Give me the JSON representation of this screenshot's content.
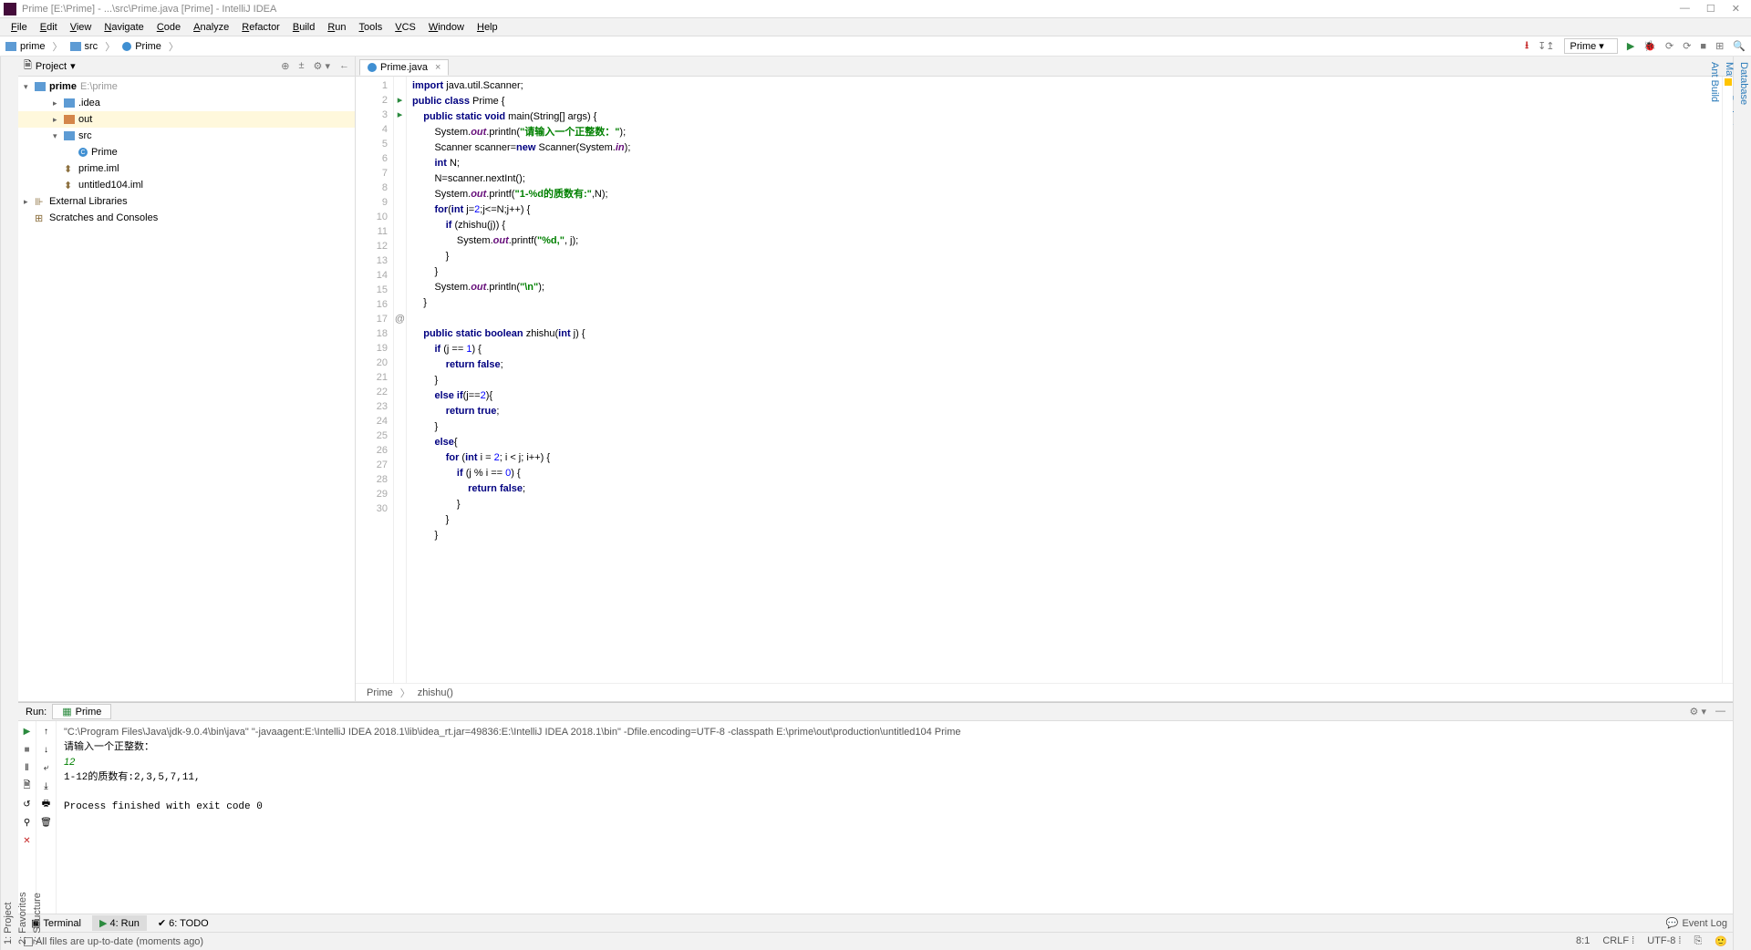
{
  "window": {
    "title": "Prime [E:\\Prime] - ...\\src\\Prime.java [Prime] - IntelliJ IDEA"
  },
  "menu": [
    "File",
    "Edit",
    "View",
    "Navigate",
    "Code",
    "Analyze",
    "Refactor",
    "Build",
    "Run",
    "Tools",
    "VCS",
    "Window",
    "Help"
  ],
  "breadcrumb": {
    "root": "prime",
    "mid": "src",
    "leaf": "Prime"
  },
  "toolbar": {
    "run_config": "Prime"
  },
  "project_panel": {
    "title": "Project",
    "root_name": "prime",
    "root_path": "E:\\prime",
    "children": [
      {
        "name": ".idea",
        "kind": "folder",
        "indent": 1,
        "exp": "▸"
      },
      {
        "name": "out",
        "kind": "folder-orange",
        "indent": 1,
        "exp": "▸",
        "selected": true
      },
      {
        "name": "src",
        "kind": "folder",
        "indent": 1,
        "exp": "▾"
      },
      {
        "name": "Prime",
        "kind": "class",
        "indent": 2,
        "exp": ""
      },
      {
        "name": "prime.iml",
        "kind": "iml",
        "indent": 1,
        "exp": ""
      },
      {
        "name": "untitled104.iml",
        "kind": "iml",
        "indent": 1,
        "exp": ""
      }
    ],
    "external_libs": "External Libraries",
    "scratches": "Scratches and Consoles"
  },
  "editor": {
    "tab_name": "Prime.java",
    "breadcrumb": {
      "cls": "Prime",
      "method": "zhishu()"
    },
    "lines": [
      {
        "n": 1,
        "tokens": [
          [
            "kw",
            "import "
          ],
          [
            "",
            "java.util.Scanner;"
          ]
        ]
      },
      {
        "n": 2,
        "mark": "▸",
        "tokens": [
          [
            "kw",
            "public class "
          ],
          [
            "",
            "Prime {"
          ]
        ]
      },
      {
        "n": 3,
        "mark": "▸",
        "tokens": [
          [
            "",
            "    "
          ],
          [
            "kw",
            "public static void "
          ],
          [
            "",
            "main(String[] args) {"
          ]
        ]
      },
      {
        "n": 4,
        "tokens": [
          [
            "",
            "        System."
          ],
          [
            "fld",
            "out"
          ],
          [
            "",
            ".println("
          ],
          [
            "str",
            "\"请输入一个正整数：\""
          ],
          [
            "",
            ");"
          ]
        ]
      },
      {
        "n": 5,
        "tokens": [
          [
            "",
            "        Scanner scanner="
          ],
          [
            "kw",
            "new "
          ],
          [
            "",
            "Scanner(System."
          ],
          [
            "fld",
            "in"
          ],
          [
            "",
            ");"
          ]
        ]
      },
      {
        "n": 6,
        "tokens": [
          [
            "",
            "        "
          ],
          [
            "kw",
            "int "
          ],
          [
            "",
            "N;"
          ]
        ]
      },
      {
        "n": 7,
        "tokens": [
          [
            "",
            "        N=scanner.nextInt();"
          ]
        ]
      },
      {
        "n": 8,
        "tokens": [
          [
            "",
            "        System."
          ],
          [
            "fld",
            "out"
          ],
          [
            "",
            ".printf("
          ],
          [
            "str",
            "\"1-%d的质数有:\""
          ],
          [
            "",
            ",N);"
          ]
        ]
      },
      {
        "n": 9,
        "tokens": [
          [
            "",
            "        "
          ],
          [
            "kw",
            "for"
          ],
          [
            "",
            "("
          ],
          [
            "kw",
            "int "
          ],
          [
            "",
            "j="
          ],
          [
            "num",
            "2"
          ],
          [
            "",
            ";j<=N;j++) {"
          ]
        ]
      },
      {
        "n": 10,
        "tokens": [
          [
            "",
            "            "
          ],
          [
            "kw",
            "if "
          ],
          [
            "",
            "("
          ],
          [
            "",
            "zhishu"
          ],
          [
            "",
            "(j)) {"
          ]
        ]
      },
      {
        "n": 11,
        "tokens": [
          [
            "",
            "                System."
          ],
          [
            "fld",
            "out"
          ],
          [
            "",
            ".printf("
          ],
          [
            "str",
            "\"%d,\""
          ],
          [
            "",
            ", j);"
          ]
        ]
      },
      {
        "n": 12,
        "tokens": [
          [
            "",
            "            }"
          ]
        ]
      },
      {
        "n": 13,
        "tokens": [
          [
            "",
            "        }"
          ]
        ]
      },
      {
        "n": 14,
        "tokens": [
          [
            "",
            "        System."
          ],
          [
            "fld",
            "out"
          ],
          [
            "",
            ".println("
          ],
          [
            "str",
            "\"\\n\""
          ],
          [
            "",
            ");"
          ]
        ]
      },
      {
        "n": 15,
        "tokens": [
          [
            "",
            "    }"
          ]
        ]
      },
      {
        "n": 16,
        "tokens": [
          [
            "",
            ""
          ]
        ]
      },
      {
        "n": 17,
        "mark": "@",
        "tokens": [
          [
            "",
            "    "
          ],
          [
            "kw",
            "public static boolean "
          ],
          [
            "",
            "zhishu("
          ],
          [
            "kw",
            "int "
          ],
          [
            "",
            "j) {"
          ]
        ]
      },
      {
        "n": 18,
        "tokens": [
          [
            "",
            "        "
          ],
          [
            "kw",
            "if "
          ],
          [
            "",
            "(j == "
          ],
          [
            "num",
            "1"
          ],
          [
            "",
            ") {"
          ]
        ]
      },
      {
        "n": 19,
        "tokens": [
          [
            "",
            "            "
          ],
          [
            "kw",
            "return false"
          ],
          [
            "",
            ";"
          ]
        ]
      },
      {
        "n": 20,
        "tokens": [
          [
            "",
            "        }"
          ]
        ]
      },
      {
        "n": 21,
        "tokens": [
          [
            "",
            "        "
          ],
          [
            "kw",
            "else if"
          ],
          [
            "",
            "(j=="
          ],
          [
            "num",
            "2"
          ],
          [
            "",
            "){"
          ]
        ]
      },
      {
        "n": 22,
        "tokens": [
          [
            "",
            "            "
          ],
          [
            "kw",
            "return true"
          ],
          [
            "",
            ";"
          ]
        ]
      },
      {
        "n": 23,
        "tokens": [
          [
            "",
            "        }"
          ]
        ]
      },
      {
        "n": 24,
        "tokens": [
          [
            "",
            "        "
          ],
          [
            "kw",
            "else"
          ],
          [
            "",
            "{"
          ]
        ]
      },
      {
        "n": 25,
        "tokens": [
          [
            "",
            "            "
          ],
          [
            "kw",
            "for "
          ],
          [
            "",
            "("
          ],
          [
            "kw",
            "int "
          ],
          [
            "",
            "i = "
          ],
          [
            "num",
            "2"
          ],
          [
            "",
            "; i < j; i++) {"
          ]
        ]
      },
      {
        "n": 26,
        "tokens": [
          [
            "",
            "                "
          ],
          [
            "kw",
            "if "
          ],
          [
            "",
            "(j % i == "
          ],
          [
            "num",
            "0"
          ],
          [
            "",
            ") {"
          ]
        ]
      },
      {
        "n": 27,
        "tokens": [
          [
            "",
            "                    "
          ],
          [
            "kw",
            "return false"
          ],
          [
            "",
            ";"
          ]
        ]
      },
      {
        "n": 28,
        "tokens": [
          [
            "",
            "                }"
          ]
        ]
      },
      {
        "n": 29,
        "tokens": [
          [
            "",
            "            }"
          ]
        ]
      },
      {
        "n": 30,
        "tokens": [
          [
            "",
            "        }"
          ]
        ]
      }
    ]
  },
  "run": {
    "label": "Run:",
    "config": "Prime",
    "cmd": "\"C:\\Program Files\\Java\\jdk-9.0.4\\bin\\java\" \"-javaagent:E:\\IntelliJ IDEA 2018.1\\lib\\idea_rt.jar=49836:E:\\IntelliJ IDEA 2018.1\\bin\" -Dfile.encoding=UTF-8 -classpath E:\\prime\\out\\production\\untitled104 Prime",
    "prompt": "请输入一个正整数：",
    "input": "12",
    "result": "1-12的质数有:2,3,5,7,11,",
    "exit": "Process finished with exit code 0"
  },
  "bottom_tabs": {
    "terminal": "Terminal",
    "run": "4: Run",
    "todo": "6: TODO",
    "event_log": "Event Log"
  },
  "status": {
    "msg": "All files are up-to-date (moments ago)",
    "pos": "8:1",
    "crlf": "CRLF",
    "enc": "UTF-8",
    "ctx": "⎘"
  },
  "left_tools": [
    "1: Project",
    "2: Favorites",
    "7: Structure"
  ],
  "right_tools": [
    "Database",
    "Maven Projects",
    "Ant Build"
  ]
}
